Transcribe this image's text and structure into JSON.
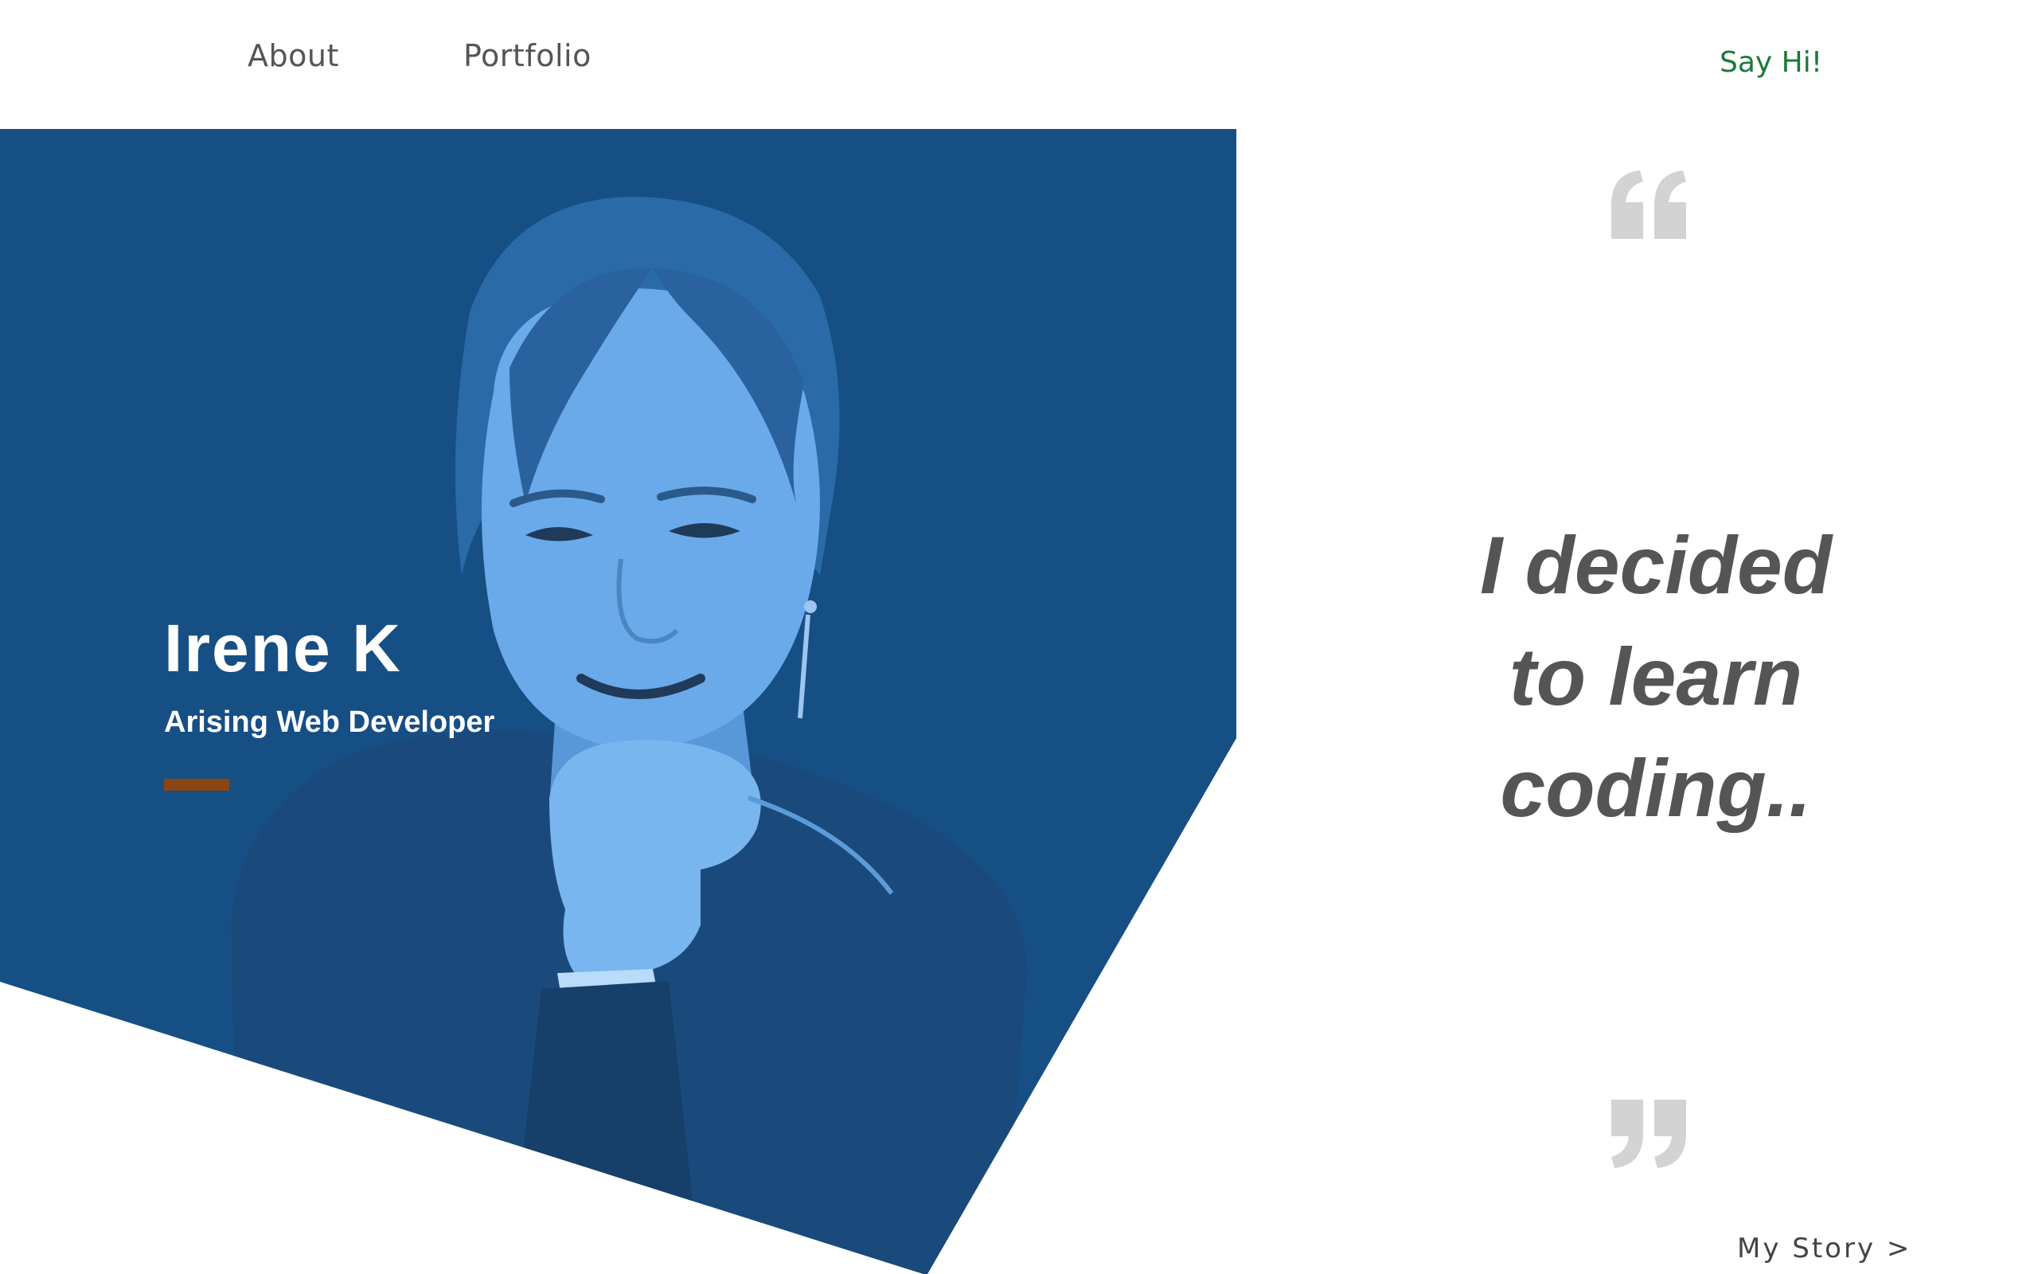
{
  "nav": {
    "about_label": "About",
    "portfolio_label": "Portfolio",
    "say_hi_label": "Say Hi!"
  },
  "hero": {
    "name": "Irene K",
    "role": "Arising Web Developer",
    "background_color": "#164f84",
    "accent_color": "#8b4513"
  },
  "quote": {
    "lines": [
      "I decided",
      "to learn",
      "coding.."
    ],
    "open_icon": "quote-open-icon",
    "close_icon": "quote-close-icon"
  },
  "footer": {
    "my_story_label": "My Story >"
  },
  "colors": {
    "nav_text": "#555555",
    "say_hi": "#1b7a3a",
    "quote_text": "#555555",
    "quote_marks": "#d3d3d3"
  }
}
